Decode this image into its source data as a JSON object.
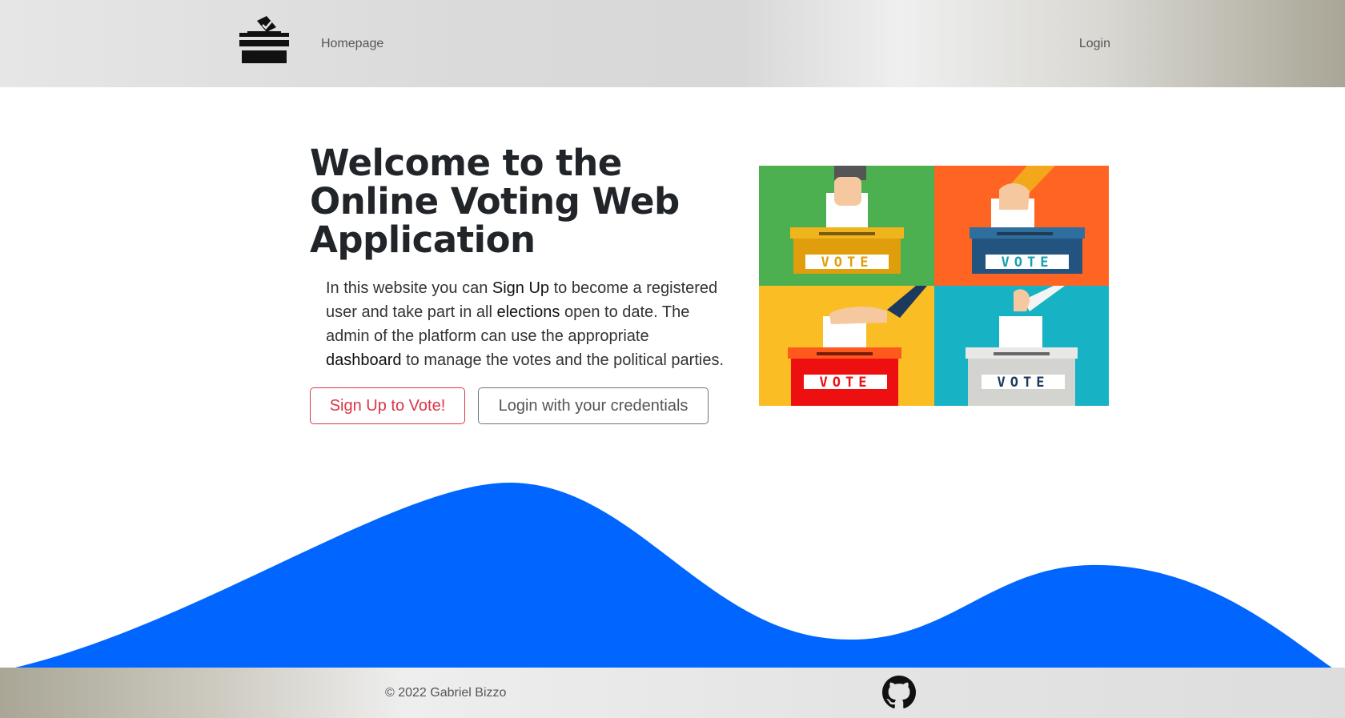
{
  "navbar": {
    "logo_icon": "ballot-box-icon",
    "home_label": "Homepage",
    "login_label": "Login"
  },
  "hero": {
    "title": "Welcome to the Online Voting Web Application",
    "lead": {
      "t1": "In this website you can ",
      "s1": "Sign Up",
      "t2": " to become a registered user and take part in all ",
      "s2": "elections",
      "t3": " open to date. The admin of the platform can use the appropriate ",
      "s3": "dashboard",
      "t4": " to manage the votes and the political parties."
    },
    "signup_button": "Sign Up to Vote!",
    "login_button": "Login with your credentials",
    "image": {
      "box_label": "VOTE",
      "colors": [
        "#4caf50",
        "#ff6422",
        "#fbbd24",
        "#17b2c3"
      ]
    }
  },
  "footer": {
    "copyright": "© 2022 Gabriel Bizzo",
    "github_icon": "github-icon"
  },
  "colors": {
    "wave": "#0066ff",
    "signup_accent": "#dc3545",
    "secondary": "#6c757d"
  }
}
